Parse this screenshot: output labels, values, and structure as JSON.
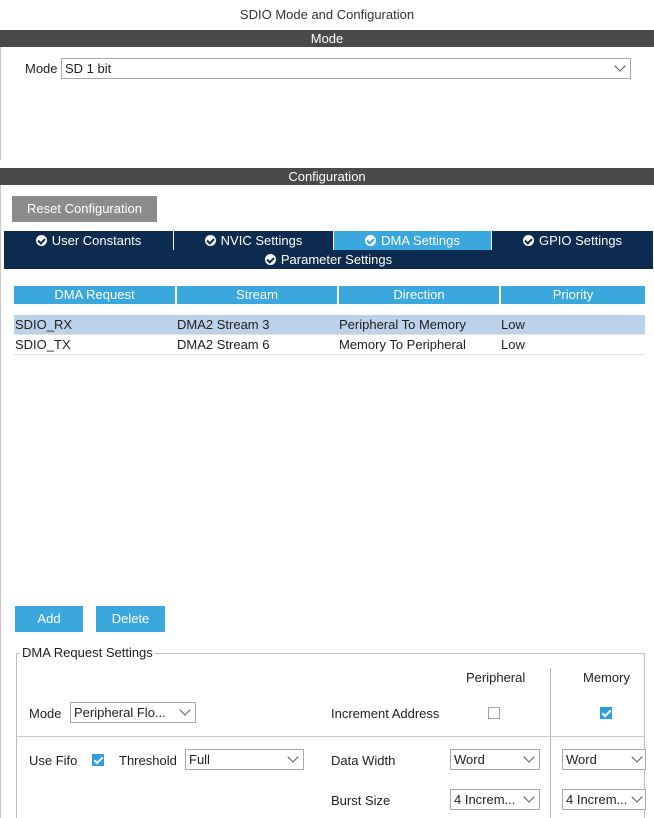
{
  "window": {
    "title": "SDIO Mode and Configuration"
  },
  "mode_section": {
    "header": "Mode",
    "mode_label": "Mode",
    "mode_value": "SD 1 bit"
  },
  "config_section": {
    "header": "Configuration",
    "reset_label": "Reset Configuration",
    "tabs": [
      {
        "label": "User Constants",
        "active": false
      },
      {
        "label": "NVIC Settings",
        "active": false
      },
      {
        "label": "DMA Settings",
        "active": true
      },
      {
        "label": "GPIO Settings",
        "active": false
      },
      {
        "label": "Parameter Settings",
        "active": false
      }
    ]
  },
  "dma_table": {
    "headers": [
      "DMA Request",
      "Stream",
      "Direction",
      "Priority"
    ],
    "rows": [
      {
        "request": "SDIO_RX",
        "stream": "DMA2 Stream 3",
        "direction": "Peripheral To Memory",
        "priority": "Low",
        "selected": true
      },
      {
        "request": "SDIO_TX",
        "stream": "DMA2 Stream 6",
        "direction": "Memory To Peripheral",
        "priority": "Low",
        "selected": false
      }
    ],
    "add_label": "Add",
    "delete_label": "Delete"
  },
  "request_settings": {
    "legend": "DMA Request Settings",
    "peripheral_header": "Peripheral",
    "memory_header": "Memory",
    "mode_label": "Mode",
    "mode_value": "Peripheral Flo...",
    "increment_label": "Increment Address",
    "increment_peripheral": false,
    "increment_memory": true,
    "use_fifo_label": "Use Fifo",
    "use_fifo": true,
    "threshold_label": "Threshold",
    "threshold_value": "Full",
    "data_width_label": "Data Width",
    "data_width_peripheral": "Word",
    "data_width_memory": "Word",
    "burst_size_label": "Burst Size",
    "burst_peripheral": "4 Increm...",
    "burst_memory": "4 Increm..."
  },
  "colors": {
    "accent": "#3aa8dc",
    "tab_dark": "#0d2b4f",
    "header_dark": "#4a4a4a",
    "selected_row": "#bcd2ea"
  },
  "icons": {
    "tab_check": "check-circle-icon",
    "dropdown": "chevron-down-icon"
  }
}
